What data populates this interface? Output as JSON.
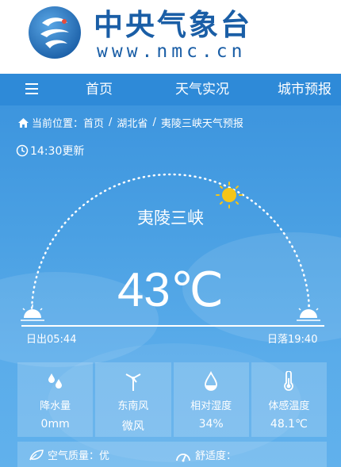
{
  "header": {
    "brand_cn": "中央气象台",
    "brand_url": "www.nmc.cn"
  },
  "nav": {
    "items": [
      {
        "label": "首页"
      },
      {
        "label": "天气实况"
      },
      {
        "label": "城市预报"
      }
    ]
  },
  "breadcrumb": {
    "prefix": "当前位置：",
    "items": [
      "首页",
      "湖北省",
      "夷陵三峡天气预报"
    ],
    "separator": "/"
  },
  "update_time": "14:30更新",
  "city": "夷陵三峡",
  "temperature": "43℃",
  "sunrise": "日出05:44",
  "sunset": "日落19:40",
  "stats": [
    {
      "icon": "droplets-icon",
      "label": "降水量",
      "value": "0mm"
    },
    {
      "icon": "wind-turbine-icon",
      "label": "东南风",
      "value": "微风"
    },
    {
      "icon": "humidity-drop-icon",
      "label": "相对湿度",
      "value": "34%"
    },
    {
      "icon": "thermometer-icon",
      "label": "体感温度",
      "value": "48.1℃"
    }
  ],
  "air_quality": "空气质量：优",
  "comfort": "舒适度："
}
